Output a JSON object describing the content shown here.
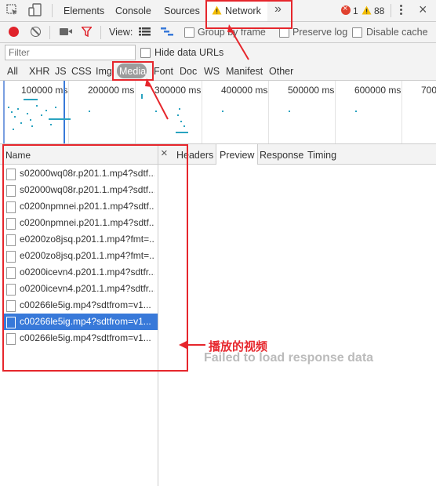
{
  "toolbar": {
    "tabs": [
      {
        "label": "Elements"
      },
      {
        "label": "Console"
      },
      {
        "label": "Sources"
      },
      {
        "label": "Network"
      }
    ],
    "more": "»",
    "error_count": "1",
    "warning_count": "88"
  },
  "network_toolbar": {
    "view_label": "View:",
    "group_by_frame": "Group by frame",
    "preserve_log": "Preserve log",
    "disable_cache": "Disable cache"
  },
  "filter_bar": {
    "placeholder": "Filter",
    "hide_data_urls": "Hide data URLs"
  },
  "type_filters": [
    "All",
    "XHR",
    "JS",
    "CSS",
    "Img",
    "Media",
    "Font",
    "Doc",
    "WS",
    "Manifest",
    "Other"
  ],
  "type_filter_active": "Media",
  "timeline": {
    "labels": [
      "100000 ms",
      "200000 ms",
      "300000 ms",
      "400000 ms",
      "500000 ms",
      "600000 ms",
      "700"
    ]
  },
  "request_list": {
    "header": "Name",
    "items": [
      {
        "name": "s02000wq08r.p201.1.mp4?sdtf..."
      },
      {
        "name": "s02000wq08r.p201.1.mp4?sdtf..."
      },
      {
        "name": "c0200npmnei.p201.1.mp4?sdtf..."
      },
      {
        "name": "c0200npmnei.p201.1.mp4?sdtf..."
      },
      {
        "name": "e0200zo8jsq.p201.1.mp4?fmt=..."
      },
      {
        "name": "e0200zo8jsq.p201.1.mp4?fmt=..."
      },
      {
        "name": "o0200icevn4.p201.1.mp4?sdtfr..."
      },
      {
        "name": "o0200icevn4.p201.1.mp4?sdtfr..."
      },
      {
        "name": "c00266le5ig.mp4?sdtfrom=v1..."
      },
      {
        "name": "c00266le5ig.mp4?sdtfrom=v1...",
        "selected": true
      },
      {
        "name": "c00266le5ig.mp4?sdtfrom=v1..."
      }
    ]
  },
  "detail": {
    "close": "×",
    "tabs": [
      "Headers",
      "Preview",
      "Response",
      "Timing"
    ],
    "active_tab": "Preview",
    "message": "Failed to load response data"
  },
  "annotation": {
    "label": "播放的视频",
    "color": "#e6262c"
  }
}
